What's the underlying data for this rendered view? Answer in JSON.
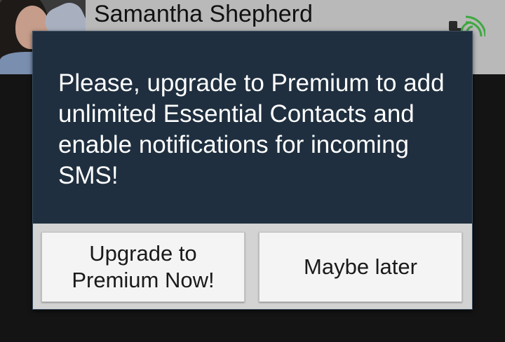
{
  "contact": {
    "name": "Samantha Shepherd",
    "call_icon": "phone-wifi-call-icon"
  },
  "dialog": {
    "message": "Please, upgrade to Premium to add unlimited Essential Contacts and enable notifications for incoming SMS!",
    "buttons": {
      "upgrade": "Upgrade to Premium Now!",
      "later": "Maybe later"
    }
  },
  "colors": {
    "dialog_background": "#1f2f3f",
    "footer_background": "#d3d3d3",
    "button_background": "#f4f4f4",
    "screen_background": "#141414",
    "call_icon_accent": "#3fa83f"
  }
}
